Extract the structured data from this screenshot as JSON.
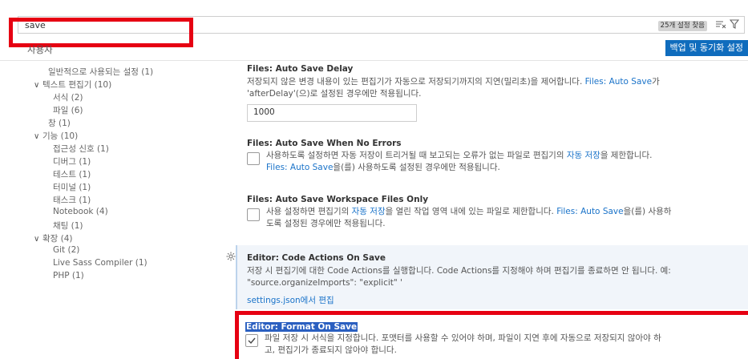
{
  "search": {
    "value": "save",
    "results_badge": "25개 설정 찾음"
  },
  "icons": {
    "clear_filter": "clear-filter-icon",
    "filter": "filter-icon",
    "gear": "gear-icon",
    "check": "check-icon",
    "chevron": "chevron-down-icon"
  },
  "scope": {
    "user_tab": "사용자",
    "backup_button": "백업 및 동기화 설정"
  },
  "toc": [
    {
      "label": "일반적으로 사용되는 설정 (1)",
      "expanded": null
    },
    {
      "label": "텍스트 편집기 (10)",
      "expanded": true
    },
    {
      "label": "서식 (2)",
      "expanded": null
    },
    {
      "label": "파일 (6)",
      "expanded": null
    },
    {
      "label": "창 (1)",
      "expanded": null
    },
    {
      "label": "기능 (10)",
      "expanded": true
    },
    {
      "label": "접근성 신호 (1)",
      "expanded": null
    },
    {
      "label": "디버그 (1)",
      "expanded": null
    },
    {
      "label": "테스트 (1)",
      "expanded": null
    },
    {
      "label": "터미널 (1)",
      "expanded": null
    },
    {
      "label": "태스크 (1)",
      "expanded": null
    },
    {
      "label": "Notebook (4)",
      "expanded": null
    },
    {
      "label": "채팅 (1)",
      "expanded": null
    },
    {
      "label": "확장 (4)",
      "expanded": true
    },
    {
      "label": "Git (2)",
      "expanded": null
    },
    {
      "label": "Live Sass Compiler (1)",
      "expanded": null
    },
    {
      "label": "PHP (1)",
      "expanded": null
    }
  ],
  "settings": {
    "auto_save_delay": {
      "title": "Files: Auto Save Delay",
      "desc_1": "저장되지 않은 변경 내용이 있는 편집기가 자동으로 저장되기까지의 지연(밀리초)을 제어합니다. ",
      "link": "Files: Auto Save",
      "desc_2": "가",
      "desc_3": "'afterDelay'(으)로 설정된 경우에만 적용됩니다.",
      "value": "1000"
    },
    "auto_save_no_errors": {
      "title": "Files: Auto Save When No Errors",
      "desc_1": "사용하도록 설정하면 자동 저장이 트리거될 때 보고되는 오류가 없는 파일로 편집기의 ",
      "link_1": "자동 저장",
      "desc_2": "을 제한합니다.",
      "link_2": "Files: Auto Save",
      "desc_3": "을(를) 사용하도록 설정된 경우에만 적용됩니다.",
      "checked": false
    },
    "auto_save_workspace": {
      "title": "Files: Auto Save Workspace Files Only",
      "desc_1": "사용 설정하면 편집기의 ",
      "link_1": "자동 저장",
      "desc_2": "을 열린 작업 영역 내에 있는 파일로 제한합니다. ",
      "link_2": "Files: Auto Save",
      "desc_3": "을(를) 사용하",
      "desc_4": "도록 설정된 경우에만 적용됩니다.",
      "checked": false
    },
    "code_actions": {
      "title": "Editor: Code Actions On Save",
      "desc_1": "저장 시 편집기에 대한 Code Actions를 실행합니다. Code Actions를 지정해야 하며 편집기를 종료하면 안 됩니다. 예:",
      "desc_2": "\"source.organizeImports\": \"explicit\" '",
      "edit_link": "settings.json에서 편집"
    },
    "format_on_save": {
      "title": "Editor: Format On Save",
      "desc_1": "파일 저장 시 서식을 지정합니다. 포맷터를 사용할 수 있어야 하며, 파일이 지연 후에 자동으로 저장되지 않아야 하",
      "desc_2": "고, 편집기가 종료되지 않아야 합니다.",
      "checked": true
    }
  },
  "colors": {
    "highlight_red": "#e60012",
    "accent_blue": "#0f6cbd",
    "link_blue": "#1a73c9"
  }
}
